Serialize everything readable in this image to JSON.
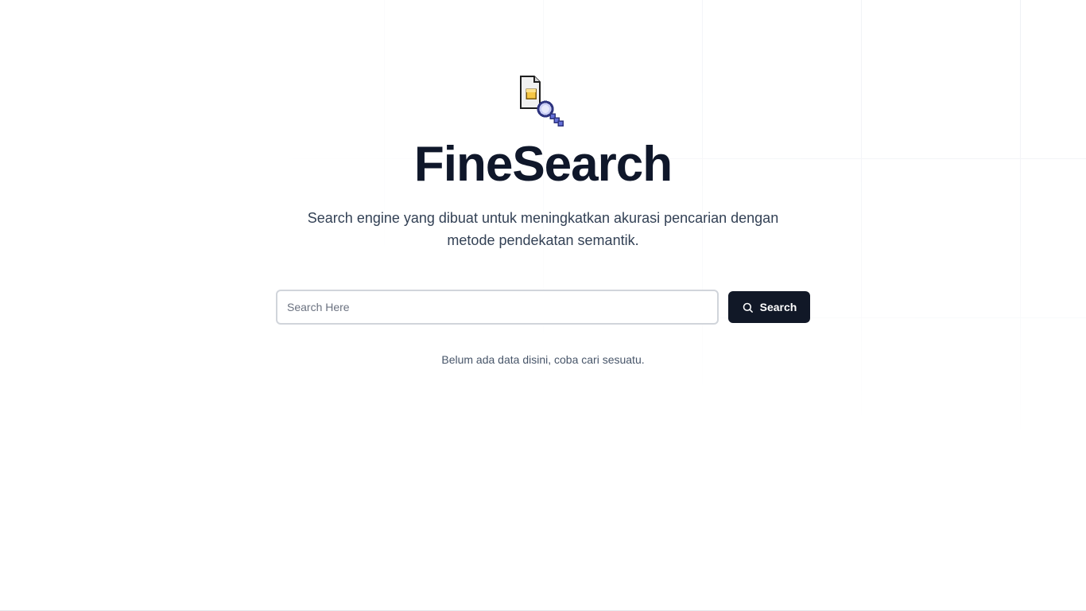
{
  "app": {
    "title": "FineSearch",
    "subtitle": "Search engine yang dibuat untuk meningkatkan akurasi pencarian dengan metode pendekatan semantik.",
    "logo_icon": "document-search-icon"
  },
  "search": {
    "placeholder": "Search Here",
    "value": "",
    "button_label": "Search",
    "button_icon": "search-icon"
  },
  "results": {
    "empty_message": "Belum ada data disini, coba cari sesuatu."
  },
  "colors": {
    "primary_text": "#0f172a",
    "button_bg": "#111827",
    "muted_text": "#475569",
    "logo_yellow": "#f6c744",
    "logo_blue": "#6470d8"
  }
}
